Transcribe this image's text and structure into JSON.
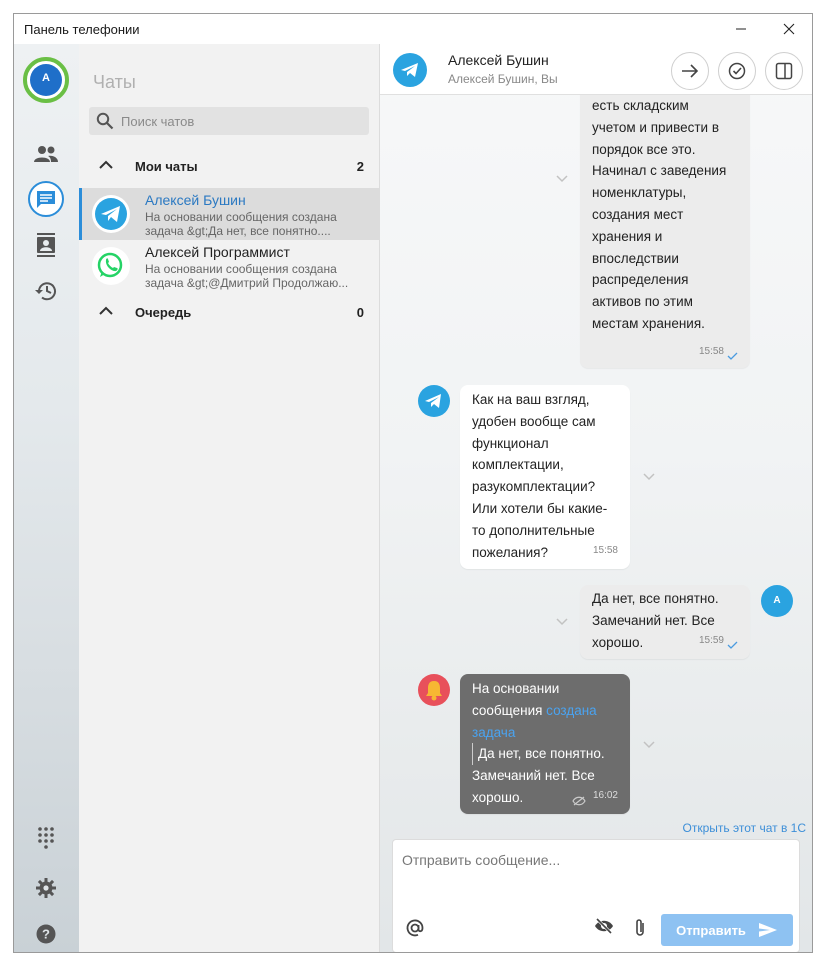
{
  "window": {
    "title": "Панель телефонии"
  },
  "rail": {
    "avatar_letter": "А"
  },
  "chatlist": {
    "title": "Чаты",
    "search_placeholder": "Поиск чатов",
    "groups": [
      {
        "label": "Мои чаты",
        "count": "2"
      },
      {
        "label": "Очередь",
        "count": "0"
      }
    ],
    "items": [
      {
        "name": "Алексей Бушин",
        "preview": "На основании сообщения создана задача &gt;Да нет, все понятно....",
        "channel": "telegram"
      },
      {
        "name": "Алексей Программист",
        "preview": "На основании сообщения создана задача &gt;@Дмитрий Продолжаю...",
        "channel": "whatsapp"
      }
    ]
  },
  "conversation": {
    "contact_name": "Алексей Бушин",
    "participants": "Алексей Бушин, Вы",
    "messages": [
      {
        "lines": [
          "есть складским",
          "учетом и привести в",
          "порядок все это.",
          "Начинал с заведения",
          "номенклатуры,",
          "создания мест",
          "хранения и",
          "впоследствии",
          "распределения",
          "активов по этим",
          "местам хранения."
        ],
        "time": "15:58",
        "from": "me"
      },
      {
        "lines": [
          "Как на ваш взгляд,",
          "удобен вообще сам",
          "функционал",
          "комплектации,",
          "разукомплектации?",
          "Или хотели бы какие-",
          "то дополнительные",
          "пожелания?"
        ],
        "time": "15:58",
        "from": "contact"
      },
      {
        "lines": [
          "Да нет, все понятно.",
          "Замечаний нет. Все",
          "хорошо."
        ],
        "time": "15:59",
        "from": "me",
        "avatar_letter": "А"
      },
      {
        "line1": "На основании",
        "line2_prefix": "сообщения ",
        "link": "создана",
        "link2": "задача",
        "quote1": "Да нет, все понятно.",
        "quote2": "Замечаний нет. Все",
        "quote3": "хорошо.",
        "time": "16:02",
        "from": "system"
      }
    ],
    "open_in_1c": "Открыть этот чат в 1С",
    "composer_placeholder": "Отправить сообщение...",
    "send_label": "Отправить"
  },
  "colors": {
    "accent": "#2b8dd9",
    "telegram": "#2aa3e0",
    "whatsapp": "#25d366",
    "notify": "#e8505b",
    "send": "#8ec2f2"
  }
}
